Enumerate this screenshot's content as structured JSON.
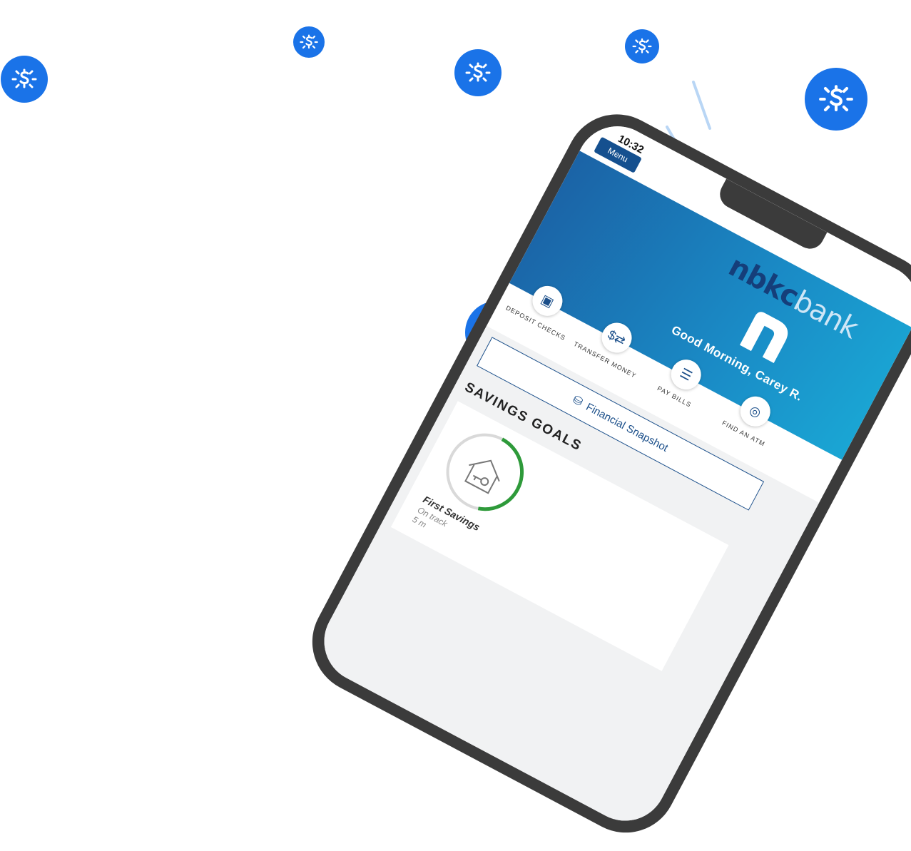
{
  "status_bar": {
    "time": "10:32"
  },
  "header": {
    "menu_label": "Menu",
    "logo_bold": "nbkc",
    "logo_thin": "bank"
  },
  "hero": {
    "greeting": "Good Morning, Carey R."
  },
  "actions": [
    {
      "label": "DEPOSIT CHECKS",
      "icon": "camera-icon",
      "glyph": "▣"
    },
    {
      "label": "TRANSFER MONEY",
      "icon": "transfer-icon",
      "glyph": "$⇄"
    },
    {
      "label": "PAY BILLS",
      "icon": "bill-icon",
      "glyph": "☰"
    },
    {
      "label": "FIND AN ATM",
      "icon": "location-pin-icon",
      "glyph": "◎"
    }
  ],
  "snapshot": {
    "label": "Financial Snapshot",
    "icon": "coins-icon",
    "glyph": "⛁"
  },
  "savings": {
    "title": "SAVINGS GOALS",
    "goals": [
      {
        "name": "First Savings",
        "status": "On track",
        "sub": "5 m",
        "progress": 0.45
      }
    ]
  },
  "colors": {
    "coin_blue": "#1a73e8",
    "brand_navy": "#15508f",
    "ring_green": "#2e9a3a"
  }
}
